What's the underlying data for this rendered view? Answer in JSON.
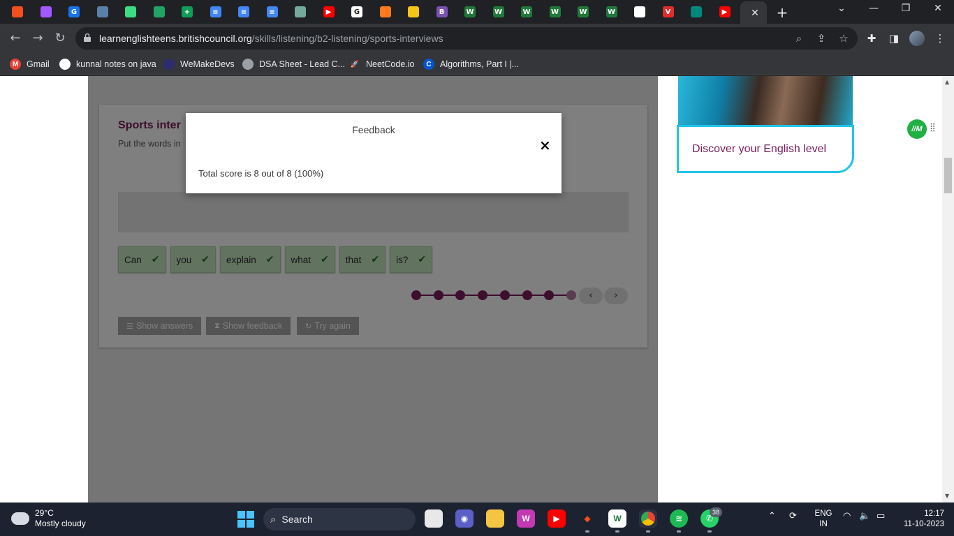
{
  "browser": {
    "tabs": [
      {
        "icon": "figma-icon",
        "color": "#f24e1e",
        "letter": ""
      },
      {
        "icon": "figma-icon",
        "color": "#a259ff",
        "letter": ""
      },
      {
        "icon": "google-icon",
        "color": "#1a73e8",
        "letter": "G"
      },
      {
        "icon": "elephant-icon",
        "color": "#5a7fa8",
        "letter": ""
      },
      {
        "icon": "android-icon",
        "color": "#3ddc84",
        "letter": ""
      },
      {
        "icon": "google-drive-icon",
        "color": "#1fa463",
        "letter": ""
      },
      {
        "icon": "google-sheets-icon",
        "color": "#0f9d58",
        "letter": "+"
      },
      {
        "icon": "google-docs-icon",
        "color": "#4285f4",
        "letter": "≡"
      },
      {
        "icon": "google-docs-icon",
        "color": "#4285f4",
        "letter": "≡"
      },
      {
        "icon": "google-docs-icon",
        "color": "#4285f4",
        "letter": "≡"
      },
      {
        "icon": "chatgpt-icon",
        "color": "#74aa9c",
        "letter": ""
      },
      {
        "icon": "youtube-icon",
        "color": "#ff0000",
        "letter": "▶"
      },
      {
        "icon": "google-icon",
        "color": "#ffffff",
        "letter": "G"
      },
      {
        "icon": "fire-icon",
        "color": "#ff7a1a",
        "letter": ""
      },
      {
        "icon": "imdb-icon",
        "color": "#f5c518",
        "letter": ""
      },
      {
        "icon": "bootstrap-icon",
        "color": "#7952b3",
        "letter": "B"
      },
      {
        "icon": "w-icon",
        "color": "#1f7a3a",
        "letter": "W"
      },
      {
        "icon": "w-icon",
        "color": "#1f7a3a",
        "letter": "W"
      },
      {
        "icon": "w-icon",
        "color": "#1f7a3a",
        "letter": "W"
      },
      {
        "icon": "w-icon",
        "color": "#1f7a3a",
        "letter": "W"
      },
      {
        "icon": "w-icon",
        "color": "#1f7a3a",
        "letter": "W"
      },
      {
        "icon": "w-icon",
        "color": "#1f7a3a",
        "letter": "W"
      },
      {
        "icon": "github-icon",
        "color": "#ffffff",
        "letter": ""
      },
      {
        "icon": "vivaldi-icon",
        "color": "#e52b2b",
        "letter": "V"
      },
      {
        "icon": "google-meet-icon",
        "color": "#00897b",
        "letter": ""
      },
      {
        "icon": "youtube-icon",
        "color": "#ff0000",
        "letter": "▶"
      }
    ],
    "active_tab_close": "✕",
    "new_tab": "+",
    "url_host": "learnenglishteens.britishcouncil.org",
    "url_path": "/skills/listening/b2-listening/sports-interviews",
    "bookmarks": [
      {
        "label": "Gmail",
        "icon": "gmail-icon",
        "color": "#ea4335",
        "letter": "M"
      },
      {
        "label": "kunnal notes on java",
        "icon": "github-icon",
        "color": "#ffffff",
        "letter": ""
      },
      {
        "label": "WeMakeDevs",
        "icon": "wemakedevs-icon",
        "color": "#2b2d6e",
        "letter": ""
      },
      {
        "label": "DSA Sheet - Lead C...",
        "icon": "globe-icon",
        "color": "#9aa0a6",
        "letter": ""
      },
      {
        "label": "NeetCode.io",
        "icon": "rocket-icon",
        "color": "#35363a",
        "letter": "🚀"
      },
      {
        "label": "Algorithms, Part I |...",
        "icon": "coursera-icon",
        "color": "#0056d2",
        "letter": "C"
      }
    ]
  },
  "exercise": {
    "title": "Sports inter",
    "instruction": "Put the words in",
    "words": [
      "Can",
      "you",
      "explain",
      "what",
      "that",
      "is?"
    ],
    "progress_total": 8,
    "progress_current": 8,
    "prev_label": "‹",
    "next_label": "›",
    "buttons": {
      "show_answers": "Show answers",
      "show_feedback": "Show feedback",
      "try_again": "Try again"
    }
  },
  "sidebar": {
    "promo_text": "Discover your English level"
  },
  "modal": {
    "title": "Feedback",
    "close": "×",
    "body": "Total score is 8 out of 8 (100%)"
  },
  "taskbar": {
    "temperature": "29°C",
    "weather": "Mostly cloudy",
    "search_placeholder": "Search",
    "whatsapp_badge": "38",
    "lang_line1": "ENG",
    "lang_line2": "IN",
    "time": "12:17",
    "date": "11-10-2023"
  }
}
